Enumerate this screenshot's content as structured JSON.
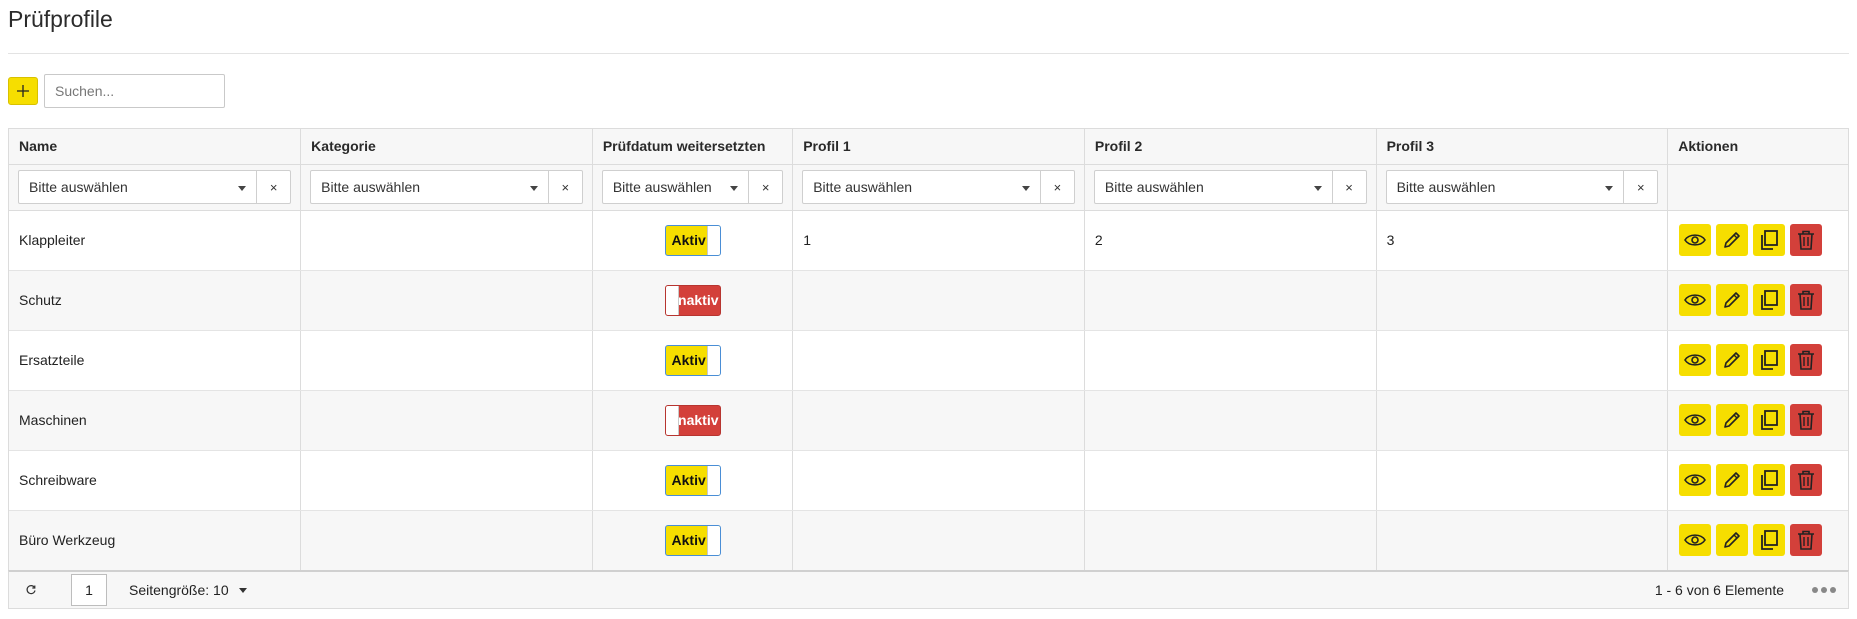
{
  "page": {
    "title": "Prüfprofile"
  },
  "toolbar": {
    "add_label": "+",
    "search_placeholder": "Suchen..."
  },
  "colors": {
    "accent": "#f6de00",
    "danger": "#d3403a",
    "header_bg": "#f7f7f7"
  },
  "columns": [
    {
      "key": "name",
      "label": "Name"
    },
    {
      "key": "category",
      "label": "Kategorie"
    },
    {
      "key": "advance",
      "label": "Prüfdatum weitersetzten"
    },
    {
      "key": "profile1",
      "label": "Profil 1"
    },
    {
      "key": "profile2",
      "label": "Profil 2"
    },
    {
      "key": "profile3",
      "label": "Profil 3"
    },
    {
      "key": "actions",
      "label": "Aktionen"
    }
  ],
  "filters": {
    "placeholder": "Bitte auswählen",
    "clear_icon": "×"
  },
  "rows": [
    {
      "name": "Klappleiter",
      "category": "",
      "advance": "Aktiv",
      "active": true,
      "profile1": "1",
      "profile2": "2",
      "profile3": "3"
    },
    {
      "name": "Schutz",
      "category": "",
      "advance": "Inaktiv",
      "active": false,
      "profile1": "",
      "profile2": "",
      "profile3": ""
    },
    {
      "name": "Ersatzteile",
      "category": "",
      "advance": "Aktiv",
      "active": true,
      "profile1": "",
      "profile2": "",
      "profile3": ""
    },
    {
      "name": "Maschinen",
      "category": "",
      "advance": "Inaktiv",
      "active": false,
      "profile1": "",
      "profile2": "",
      "profile3": ""
    },
    {
      "name": "Schreibware",
      "category": "",
      "advance": "Aktiv",
      "active": true,
      "profile1": "",
      "profile2": "",
      "profile3": ""
    },
    {
      "name": "Büro Werkzeug",
      "category": "",
      "advance": "Aktiv",
      "active": true,
      "profile1": "",
      "profile2": "",
      "profile3": ""
    }
  ],
  "row_actions": [
    {
      "name": "view-icon",
      "style": "yellow"
    },
    {
      "name": "edit-icon",
      "style": "yellow"
    },
    {
      "name": "copy-icon",
      "style": "yellow"
    },
    {
      "name": "trash-icon",
      "style": "red"
    }
  ],
  "pager": {
    "current_page": "1",
    "page_size_label": "Seitengröße: 10",
    "info": "1 - 6 von 6 Elemente"
  }
}
